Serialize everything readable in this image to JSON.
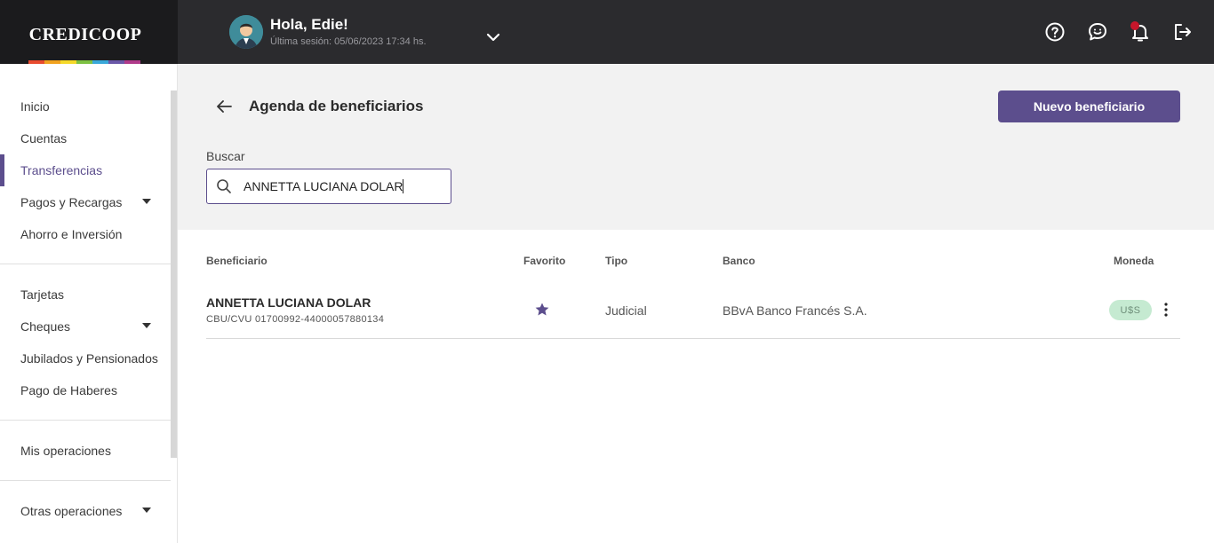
{
  "brand": {
    "name": "CREDICOOP",
    "rainbow": [
      "#e84b2f",
      "#f1a21f",
      "#f5d92a",
      "#7dc142",
      "#3aa8d9",
      "#6a58a8",
      "#b03a8a"
    ]
  },
  "user": {
    "greeting": "Hola, Edie!",
    "last_session": "Última sesión: 05/06/2023 17:34 hs."
  },
  "top_icons": [
    "help-icon",
    "chat-icon",
    "bell-icon",
    "logout-icon"
  ],
  "sidebar": {
    "items": [
      {
        "label": "Inicio"
      },
      {
        "label": "Cuentas"
      },
      {
        "label": "Transferencias",
        "active": true
      },
      {
        "label": "Pagos y Recargas",
        "expandable": true
      },
      {
        "label": "Ahorro e Inversión"
      },
      {
        "label": "Tarjetas"
      },
      {
        "label": "Cheques",
        "expandable": true
      },
      {
        "label": "Jubilados y Pensionados"
      },
      {
        "label": "Pago de Haberes"
      },
      {
        "label": "Mis operaciones"
      },
      {
        "label": "Otras operaciones",
        "expandable": true
      }
    ]
  },
  "page": {
    "title": "Agenda de beneficiarios",
    "new_button": "Nuevo beneficiario"
  },
  "search": {
    "label": "Buscar",
    "value": "ANNETTA LUCIANA DOLAR"
  },
  "table": {
    "headers": {
      "beneficiario": "Beneficiario",
      "favorito": "Favorito",
      "tipo": "Tipo",
      "banco": "Banco",
      "moneda": "Moneda"
    },
    "rows": [
      {
        "name": "ANNETTA LUCIANA DOLAR",
        "cbu": "CBU/CVU 01700992-44000057880134",
        "favorite": true,
        "tipo": "Judicial",
        "banco": "BBvA Banco Francés S.A.",
        "moneda": "U$S"
      }
    ]
  },
  "colors": {
    "accent": "#5c4e8d",
    "topbar": "#2b2b2e",
    "badge_bg": "#c5ead1",
    "notification": "#c7162b"
  }
}
